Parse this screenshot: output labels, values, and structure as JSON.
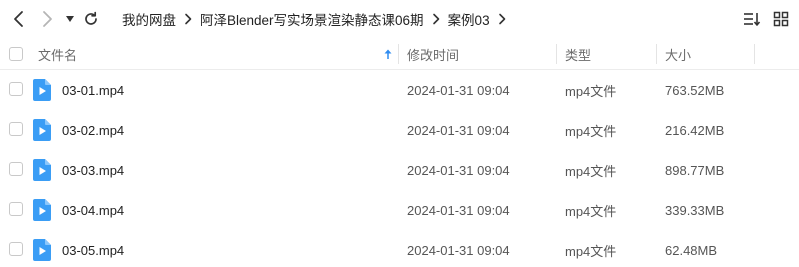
{
  "toolbar": {
    "breadcrumbs": [
      "我的网盘",
      "阿泽Blender写实场景渲染静态课06期",
      "案例03"
    ]
  },
  "table": {
    "headers": {
      "name": "文件名",
      "mtime": "修改时间",
      "type": "类型",
      "size": "大小"
    },
    "rows": [
      {
        "name": "03-01.mp4",
        "mtime": "2024-01-31 09:04",
        "type": "mp4文件",
        "size": "763.52MB"
      },
      {
        "name": "03-02.mp4",
        "mtime": "2024-01-31 09:04",
        "type": "mp4文件",
        "size": "216.42MB"
      },
      {
        "name": "03-03.mp4",
        "mtime": "2024-01-31 09:04",
        "type": "mp4文件",
        "size": "898.77MB"
      },
      {
        "name": "03-04.mp4",
        "mtime": "2024-01-31 09:04",
        "type": "mp4文件",
        "size": "339.33MB"
      },
      {
        "name": "03-05.mp4",
        "mtime": "2024-01-31 09:04",
        "type": "mp4文件",
        "size": "62.48MB"
      }
    ]
  },
  "colors": {
    "file_icon": "#3a9df5",
    "sort_arrow": "#2f8cf0"
  },
  "icons": {
    "back": "chevron-left-icon",
    "forward": "chevron-right-icon",
    "dropdown": "caret-down-icon",
    "refresh": "refresh-icon",
    "sort": "sort-list-icon",
    "grid": "grid-view-icon",
    "file": "video-file-icon"
  }
}
